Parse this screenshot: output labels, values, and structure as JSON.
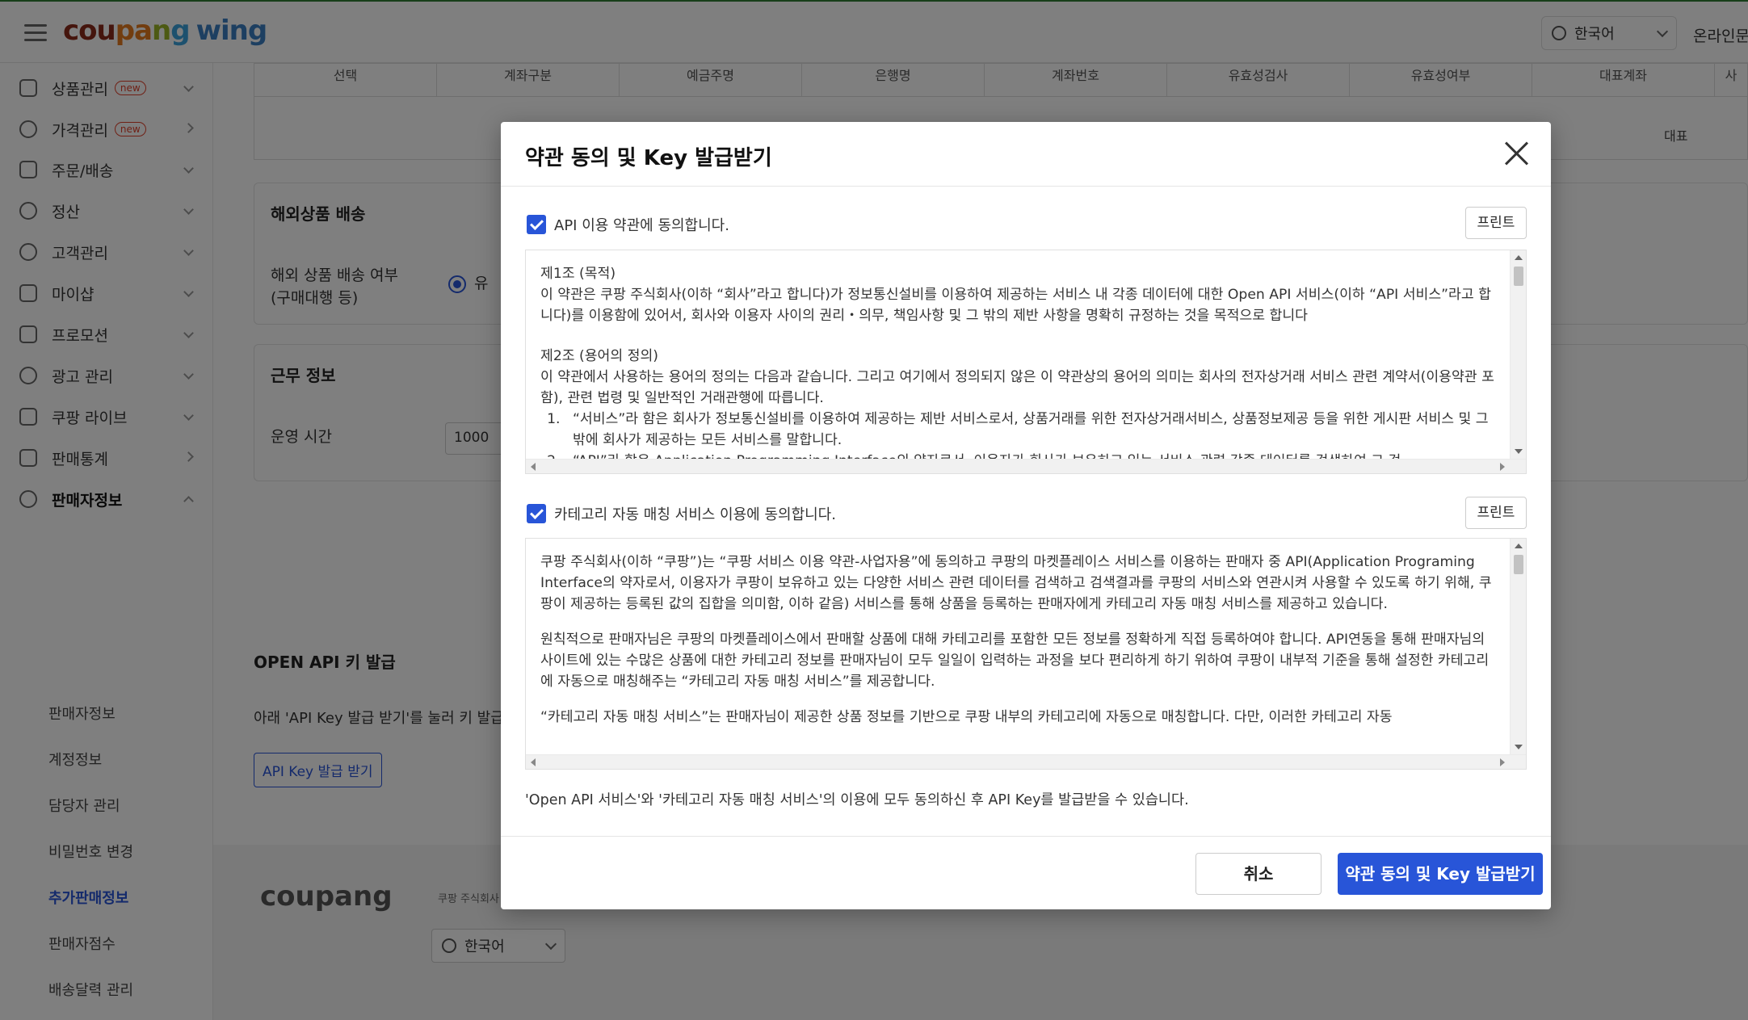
{
  "topbar": {
    "logo_parts": [
      "cou",
      "pa",
      "n",
      "g"
    ],
    "logo_wing": "wing",
    "language": "한국어",
    "right_link": "온라인문"
  },
  "sidebar": {
    "items": [
      {
        "label": "상품관리",
        "badge": "new",
        "icon": "box-icon",
        "arrow": "down"
      },
      {
        "label": "가격관리",
        "badge": "new",
        "icon": "medal-icon",
        "arrow": "right"
      },
      {
        "label": "주문/배송",
        "badge": "",
        "icon": "truck-icon",
        "arrow": "down"
      },
      {
        "label": "정산",
        "badge": "",
        "icon": "won-coin-icon",
        "arrow": "down"
      },
      {
        "label": "고객관리",
        "badge": "",
        "icon": "smile-icon",
        "arrow": "down"
      },
      {
        "label": "마이샵",
        "badge": "",
        "icon": "shop-icon",
        "arrow": "down"
      },
      {
        "label": "프로모션",
        "badge": "",
        "icon": "coupon-icon",
        "arrow": "down"
      },
      {
        "label": "광고 관리",
        "badge": "",
        "icon": "ad-clock-icon",
        "arrow": "down"
      },
      {
        "label": "쿠팡 라이브",
        "badge": "",
        "icon": "live-icon",
        "arrow": "down"
      },
      {
        "label": "판매통계",
        "badge": "",
        "icon": "bar-chart-icon",
        "arrow": "right"
      },
      {
        "label": "판매자정보",
        "badge": "",
        "icon": "person-icon",
        "arrow": "up"
      }
    ],
    "sub_items": [
      "판매자정보",
      "계정정보",
      "담당자 관리",
      "비밀번호 변경",
      "추가판매정보",
      "판매자점수",
      "배송달력 관리"
    ],
    "active_sub": "추가판매정보"
  },
  "main": {
    "table_headers": [
      "선택",
      "계좌구분",
      "예금주명",
      "은행명",
      "계좌번호",
      "유효성검사",
      "유효성여부",
      "대표계좌",
      "사"
    ],
    "table_rep_value": "대표",
    "overseas": {
      "title": "해외상품 배송",
      "label_line1": "해외 상품 배송 여부",
      "label_line2": "(구매대행 등)",
      "radio_label": "유"
    },
    "work": {
      "title": "근무 정보",
      "label": "운영 시간",
      "value": "1000"
    },
    "openapi": {
      "title": "OPEN API 키 발급",
      "desc": "아래 'API Key 발급 받기'를 눌러 키 발급",
      "button": "API Key 발급 받기"
    },
    "footer": {
      "logo": "coupang",
      "text": "쿠팡 주식회사",
      "language": "한국어"
    }
  },
  "modal": {
    "title": "약관 동의 및 Key 발급받기",
    "agree1": "API 이용 약관에 동의합니다.",
    "agree2": "카테고리 자동 매칭 서비스 이용에 동의합니다.",
    "print": "프린트",
    "terms1": {
      "art1_title": "제1조 (목적)",
      "art1_body": "이 약관은 쿠팡 주식회사(이하 “회사”라고 합니다)가 정보통신설비를 이용하여 제공하는 서비스 내 각종 데이터에 대한 Open API 서비스(이하 “API 서비스”라고 합니다)를 이용함에 있어서, 회사와 이용자 사이의 권리・의무, 책임사항 및 그 밖의 제반 사항을 명확히 규정하는 것을 목적으로 합니다",
      "art2_title": "제2조 (용어의 정의)",
      "art2_body": "이 약관에서 사용하는 용어의 정의는 다음과 같습니다. 그리고 여기에서 정의되지 않은 이 약관상의 용어의 의미는 회사의 전자상거래 서비스 관련 계약서(이용약관 포함), 관련 법령 및 일반적인 거래관행에 따릅니다.",
      "item1": "“서비스”라 함은 회사가 정보통신설비를 이용하여 제공하는 제반 서비스로서, 상품거래를 위한 전자상거래서비스, 상품정보제공 등을 위한 게시판 서비스 및 그 밖에 회사가 제공하는 모든 서비스를 말합니다.",
      "item2": "“API”라 함은 Application Programming Interface의 약자로서, 이용자가 회사가 보유하고 있는 서비스 관련 각종 데이터를 검색하여 그 검"
    },
    "terms2": {
      "p1": "쿠팡 주식회사(이하 “쿠팡”)는 “쿠팡 서비스 이용 약관-사업자용”에 동의하고 쿠팡의 마켓플레이스 서비스를 이용하는 판매자 중 API(Application Programing Interface의 약자로서, 이용자가 쿠팡이 보유하고 있는 다양한 서비스 관련 데이터를 검색하고 검색결과를 쿠팡의 서비스와 연관시켜 사용할 수 있도록 하기 위해, 쿠팡이 제공하는 등록된 값의 집합을 의미함, 이하 같음) 서비스를 통해 상품을 등록하는 판매자에게 카테고리 자동 매칭 서비스를 제공하고 있습니다.",
      "p2": "원칙적으로 판매자님은 쿠팡의 마켓플레이스에서 판매할 상품에 대해 카테고리를 포함한 모든 정보를 정확하게 직접 등록하여야 합니다. API연동을 통해 판매자님의 사이트에 있는 수많은 상품에 대한 카테고리 정보를 판매자님이 모두 일일이 입력하는 과정을 보다 편리하게 하기 위하여 쿠팡이 내부적 기준을 통해 설정한 카테고리에 자동으로 매칭해주는 “카테고리 자동 매칭 서비스”를 제공합니다.",
      "p3": "“카테고리 자동 매칭 서비스”는 판매자님이 제공한 상품 정보를 기반으로 쿠팡 내부의 카테고리에 자동으로 매칭합니다. 다만, 이러한 카테고리 자동"
    },
    "notice": "'Open API 서비스'와 '카테고리 자동 매칭 서비스'의 이용에 모두 동의하신 후 API Key를 발급받을 수 있습니다.",
    "cancel": "취소",
    "confirm": "약관 동의 및 Key 발급받기"
  },
  "colors": {
    "primary": "#2855d8",
    "overlay": "rgba(0,0,0,0.5)",
    "new_badge": "#e0402a"
  }
}
